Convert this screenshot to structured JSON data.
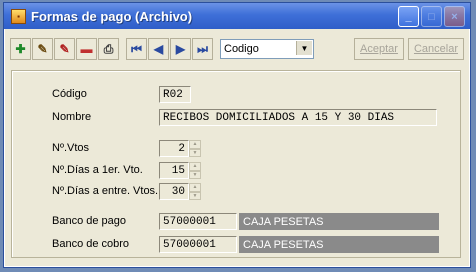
{
  "window": {
    "title": "Formas de pago (Archivo)"
  },
  "toolbar": {
    "icons": [
      "add-icon",
      "edit-icon",
      "edit-alt-icon",
      "delete-icon",
      "print-icon",
      "first-record-icon",
      "prev-record-icon",
      "next-record-icon",
      "last-record-icon"
    ],
    "order_select": "Codigo",
    "accept_label": "Aceptar",
    "cancel_label": "Cancelar"
  },
  "form": {
    "codigo_label": "Código",
    "codigo_value": "R02",
    "nombre_label": "Nombre",
    "nombre_value": "RECIBOS DOMICILIADOS A 15 Y 30 DIAS",
    "nvtos_label": "Nº.Vtos",
    "nvtos_value": "2",
    "dias_primer_label": "Nº.Días a 1er. Vto.",
    "dias_primer_value": "15",
    "dias_entre_label": "Nº.Días a entre. Vtos.",
    "dias_entre_value": "30",
    "banco_pago_label": "Banco de pago",
    "banco_pago_code": "57000001",
    "banco_pago_name": "CAJA PESETAS",
    "banco_cobro_label": "Banco de cobro",
    "banco_cobro_code": "57000001",
    "banco_cobro_name": "CAJA PESETAS"
  }
}
